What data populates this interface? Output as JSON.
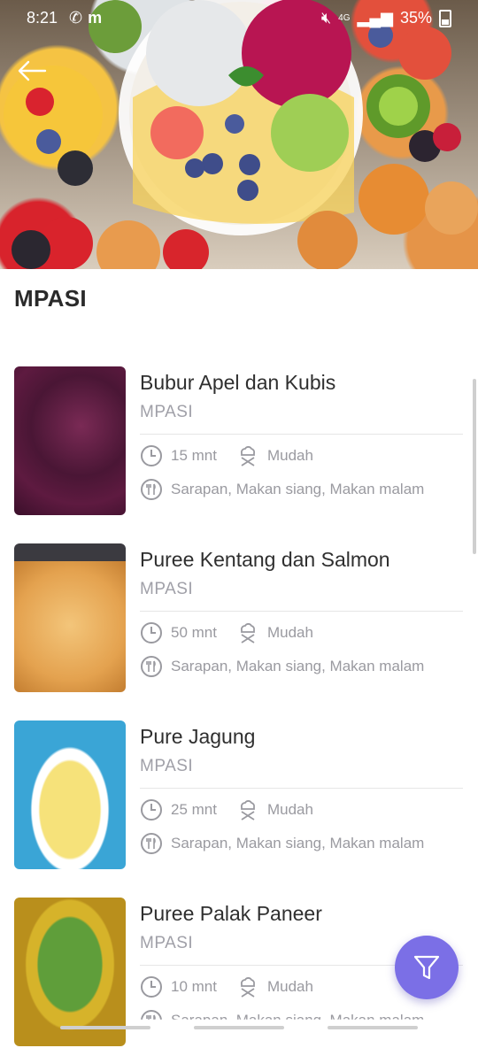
{
  "status_bar": {
    "time": "8:21",
    "left_icons": [
      "whatsapp-icon",
      "m-app-icon"
    ],
    "network": "4G",
    "battery": "35%"
  },
  "header": {
    "back_icon": "arrow-left-icon",
    "hero_image": "fruit bowl photo"
  },
  "page": {
    "title": "MPASI"
  },
  "recipes": [
    {
      "title": "Bubur Apel dan Kubis",
      "category": "MPASI",
      "time": "15 mnt",
      "difficulty": "Mudah",
      "meals": "Sarapan, Makan siang, Makan malam"
    },
    {
      "title": "Puree Kentang dan Salmon",
      "category": "MPASI",
      "time": "50 mnt",
      "difficulty": "Mudah",
      "meals": "Sarapan, Makan siang, Makan malam"
    },
    {
      "title": "Pure Jagung",
      "category": "MPASI",
      "time": "25 mnt",
      "difficulty": "Mudah",
      "meals": "Sarapan, Makan siang, Makan malam"
    },
    {
      "title": "Puree Palak Paneer",
      "category": "MPASI",
      "time": "10 mnt",
      "difficulty": "Mudah",
      "meals": "Sarapan, Makan siang, Makan malam"
    }
  ],
  "fab": {
    "icon": "filter-icon"
  },
  "colors": {
    "accent": "#7b6fe6",
    "muted_text": "#9a9aa0"
  }
}
